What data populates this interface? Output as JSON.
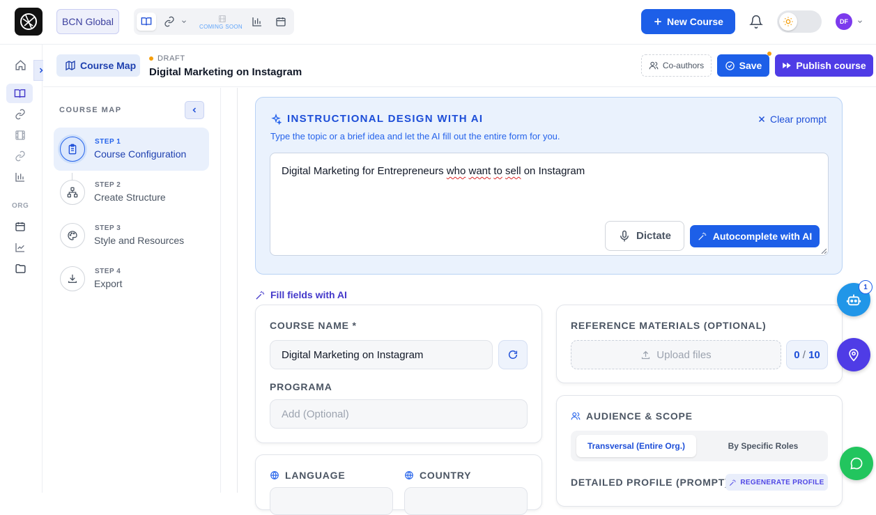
{
  "topbar": {
    "org_label": "BCN Global",
    "coming_soon": "COMING SOON",
    "new_course_label": "New Course",
    "avatar_initials": "DF",
    "theme": "light"
  },
  "sidebar": {
    "org_section_label": "ORG",
    "items": [
      "home",
      "courses",
      "links",
      "media",
      "links-2",
      "analytics",
      "calendar",
      "reports",
      "folder"
    ]
  },
  "header": {
    "course_map_label": "Course Map",
    "status": "DRAFT",
    "course_title": "Digital Marketing on Instagram",
    "coauthors_label": "Co-authors",
    "save_label": "Save",
    "publish_label": "Publish course"
  },
  "steps": {
    "title": "COURSE MAP",
    "items": [
      {
        "num": "STEP 1",
        "name": "Course Configuration",
        "active": true,
        "icon": "clipboard-icon"
      },
      {
        "num": "STEP 2",
        "name": "Create Structure",
        "active": false,
        "icon": "sitemap-icon"
      },
      {
        "num": "STEP 3",
        "name": "Style and Resources",
        "active": false,
        "icon": "palette-icon"
      },
      {
        "num": "STEP 4",
        "name": "Export",
        "active": false,
        "icon": "download-icon"
      }
    ]
  },
  "ai_panel": {
    "title": "INSTRUCTIONAL DESIGN WITH AI",
    "subtitle": "Type the topic or a brief idea and let the AI fill out the entire form for you.",
    "clear_label": "Clear prompt",
    "prompt_value": {
      "p1": "Digital Marketing for Entrepreneurs ",
      "w1": "who",
      "s1": " ",
      "w2": "want",
      "s2": " ",
      "w3": "to",
      "s3": " ",
      "w4": "sell",
      "p2": " on Instagram"
    },
    "dictate_label": "Dictate",
    "autocomplete_label": "Autocomplete with AI"
  },
  "fill_fields_label": "Fill fields with AI",
  "course_name": {
    "label": "COURSE NAME *",
    "value": "Digital Marketing on Instagram",
    "programa_label": "PROGRAMA",
    "programa_placeholder": "Add (Optional)"
  },
  "references": {
    "label": "REFERENCE MATERIALS (OPTIONAL)",
    "upload_label": "Upload files",
    "count": "0",
    "max": "10"
  },
  "audience": {
    "label": "AUDIENCE & SCOPE",
    "option_a": "Transversal (Entire Org.)",
    "option_b": "By Specific Roles",
    "selected": "Transversal (Entire Org.)",
    "profile_label": "DETAILED PROFILE (PROMPT)",
    "regenerate_label": "REGENERATE PROFILE"
  },
  "locale": {
    "language_label": "LANGUAGE",
    "country_label": "COUNTRY"
  },
  "floating": {
    "bot_badge": "1"
  },
  "colors": {
    "primary": "#1d5fe8",
    "publish": "#4f3ce6",
    "ai_panel_bg": "#eaf2fd",
    "chat_fab": "#22c55e",
    "draft_dot": "#f59e0b"
  }
}
